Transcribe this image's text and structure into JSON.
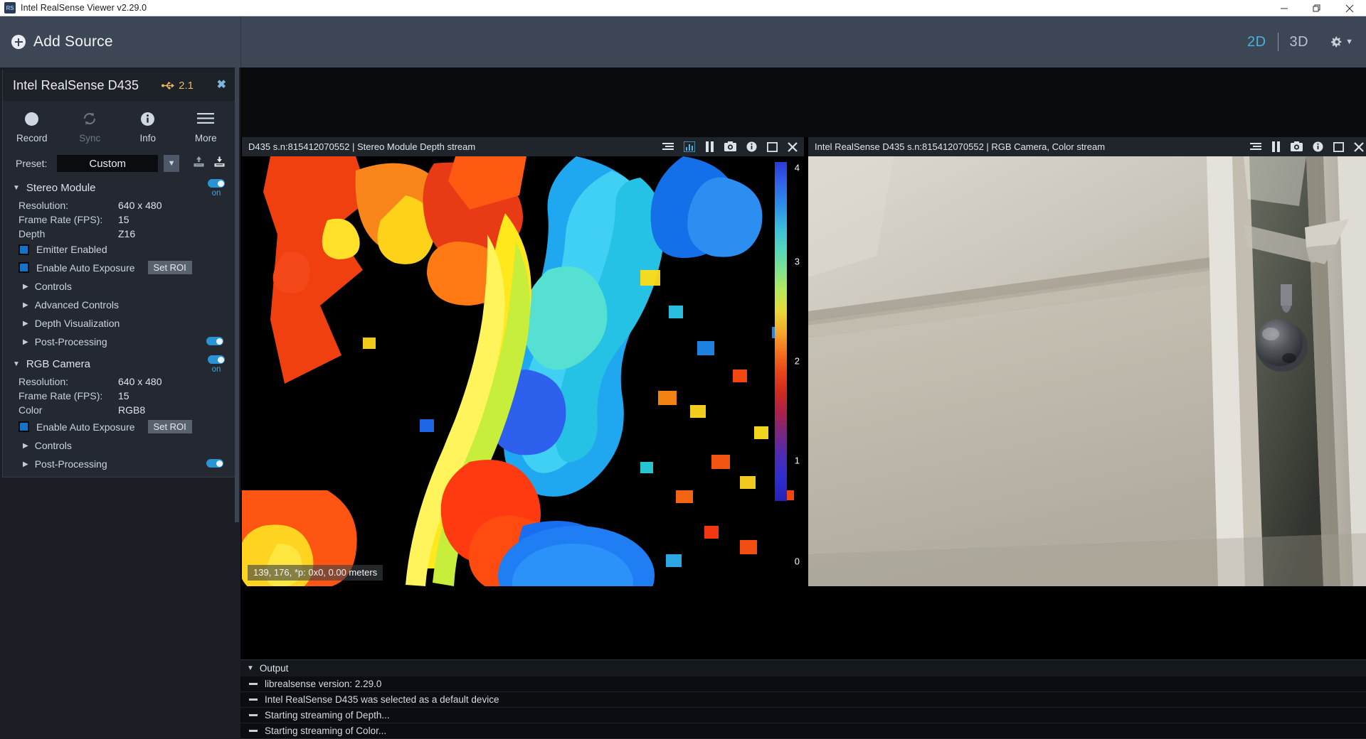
{
  "window": {
    "title": "Intel RealSense Viewer v2.29.0",
    "app_icon": "realsense-logo-icon",
    "minimize": "minimize-icon",
    "maximize": "restore-icon",
    "close": "close-icon"
  },
  "topbar": {
    "add_source": "Add Source",
    "view_2d": "2D",
    "view_3d": "3D",
    "active_view": "2D",
    "settings_icon": "gear-icon"
  },
  "device": {
    "name": "Intel RealSense D435",
    "usb_version": "2.1",
    "usb_icon": "usb-icon",
    "close_label": "✖",
    "actions": [
      {
        "label": "Record",
        "icon": "record-dot-icon",
        "enabled": true
      },
      {
        "label": "Sync",
        "icon": "sync-icon",
        "enabled": false
      },
      {
        "label": "Info",
        "icon": "info-icon",
        "enabled": true
      },
      {
        "label": "More",
        "icon": "hamburger-icon",
        "enabled": true
      }
    ],
    "preset": {
      "label": "Preset:",
      "value": "Custom",
      "arrow": "▼",
      "upload_icon": "upload-icon",
      "download_icon": "download-icon"
    }
  },
  "stereo_module": {
    "title": "Stereo Module",
    "expanded_arrow": "▼",
    "toggle_state": "on",
    "rows": [
      {
        "key": "Resolution:",
        "value": "640 x 480"
      },
      {
        "key": "Frame Rate (FPS):",
        "value": "15"
      },
      {
        "key": "Depth",
        "value": "Z16"
      }
    ],
    "checkboxes": [
      {
        "label": "Emitter Enabled",
        "checked": true,
        "button": ""
      },
      {
        "label": "Enable Auto Exposure",
        "checked": true,
        "button": "Set ROI"
      }
    ],
    "subsections": [
      {
        "label": "Controls",
        "arrow": "▶",
        "toggle": false
      },
      {
        "label": "Advanced Controls",
        "arrow": "▶",
        "toggle": false
      },
      {
        "label": "Depth Visualization",
        "arrow": "▶",
        "toggle": false
      },
      {
        "label": "Post-Processing",
        "arrow": "▶",
        "toggle": true
      }
    ]
  },
  "rgb_camera": {
    "title": "RGB Camera",
    "expanded_arrow": "▼",
    "toggle_state": "on",
    "rows": [
      {
        "key": "Resolution:",
        "value": "640 x 480"
      },
      {
        "key": "Frame Rate (FPS):",
        "value": "15"
      },
      {
        "key": "Color",
        "value": "RGB8"
      }
    ],
    "checkboxes": [
      {
        "label": "Enable Auto Exposure",
        "checked": true,
        "button": "Set ROI"
      }
    ],
    "subsections": [
      {
        "label": "Controls",
        "arrow": "▶",
        "toggle": false
      },
      {
        "label": "Post-Processing",
        "arrow": "▶",
        "toggle": true
      }
    ]
  },
  "depth_stream": {
    "title": "D435 s.n:815412070552 | Stereo Module Depth stream",
    "icons": [
      {
        "name": "metadata-icon",
        "active": false
      },
      {
        "name": "histogram-icon",
        "active": true
      },
      {
        "name": "pause-icon",
        "active": false
      },
      {
        "name": "snapshot-icon",
        "active": false
      },
      {
        "name": "info-icon",
        "active": false
      },
      {
        "name": "maximize-icon",
        "active": false
      },
      {
        "name": "close-icon",
        "active": false
      }
    ],
    "overlay": "139, 176, *p: 0x0, 0.00 meters",
    "colorbar_ticks": [
      "4",
      "3",
      "2",
      "1",
      "0"
    ],
    "colorbar_unit": "meters"
  },
  "color_stream": {
    "title": "Intel RealSense D435 s.n:815412070552 | RGB Camera, Color stream",
    "icons": [
      {
        "name": "metadata-icon",
        "active": false
      },
      {
        "name": "pause-icon",
        "active": false
      },
      {
        "name": "snapshot-icon",
        "active": false
      },
      {
        "name": "info-icon",
        "active": false
      },
      {
        "name": "maximize-icon",
        "active": false
      },
      {
        "name": "close-icon",
        "active": false
      }
    ]
  },
  "output": {
    "title": "Output",
    "arrow": "▼",
    "lines": [
      "librealsense version: 2.29.0",
      "Intel RealSense D435 was selected as a default device",
      "Starting streaming of Depth...",
      "Starting streaming of Color..."
    ]
  },
  "colors": {
    "accent": "#4fb4e4",
    "panel": "#242931",
    "topbar": "#3c4654",
    "usb": "#e6b861"
  }
}
